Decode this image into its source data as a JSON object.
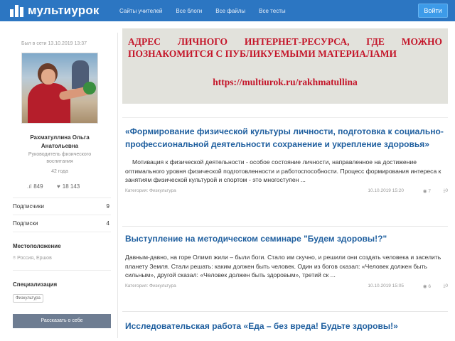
{
  "header": {
    "logo_text": "мультиурок",
    "nav": [
      "Сайты учителей",
      "Все блоги",
      "Все файлы",
      "Все тесты"
    ],
    "login_label": "Войти"
  },
  "profile": {
    "last_visit": "Был в сети 13.10.2019 13:37",
    "name_line1": "Рахматуллина Ольга",
    "name_line2": "Анатольевна",
    "role_line1": "Руководитель физического",
    "role_line2": "воспитания",
    "age": "42 года",
    "stat_rating": "849",
    "stat_views": "18 143",
    "subscribers_label": "Подписчики",
    "subscribers_count": "9",
    "subscriptions_label": "Подписки",
    "subscriptions_count": "4",
    "location_title": "Местоположение",
    "location_value": "Россия, Ершов",
    "specialization_title": "Специализация",
    "specialization_tag": "Физкультура",
    "tell_button": "Рассказать о себе"
  },
  "banner": {
    "line1": "АДРЕС ЛИЧНОГО ИНТЕРНЕТ-РЕСУРСА, ГДЕ МОЖНО",
    "line2": "ПОЗНАКОМИТСЯ С ПУБЛИКУЕМЫМИ МАТЕРИАЛАМИ",
    "url": "https://multiurok.ru/rakhmatullina"
  },
  "articles": [
    {
      "title": "«Формирование физической культуры личности, подготовка к социально-профессиональной деятельности сохранение и укрепление здоровья»",
      "text": "Мотивация к физической деятельности - особое состояние личности, направленное на достижение оптимального уровня физической подготовленности и работоспособности. Процесс формирования интереса к занятиям физической культурой и спортом - это многоступен ...",
      "category": "Категория: Физкультура",
      "date": "10.10.2019 15:20",
      "views": "7",
      "downloads": "0"
    },
    {
      "title": "Выступление на методическом семинаре \"Будем здоровы!?\"",
      "text": "Давным-давно, на горе Олимп жили – были боги. Стало им скучно, и решили они создать человека и заселить планету Земля. Стали решать: каким должен быть человек. Один из богов сказал: «Человек должен быть сильным», другой сказал: «Человек должен быть здоровым», третий ск ...",
      "category": "Категория: Физкультура",
      "date": "10.10.2019 15:05",
      "views": "6",
      "downloads": "0"
    },
    {
      "title": "Исследовательская работа «Еда – без вреда! Будьте здоровы!»"
    }
  ]
}
